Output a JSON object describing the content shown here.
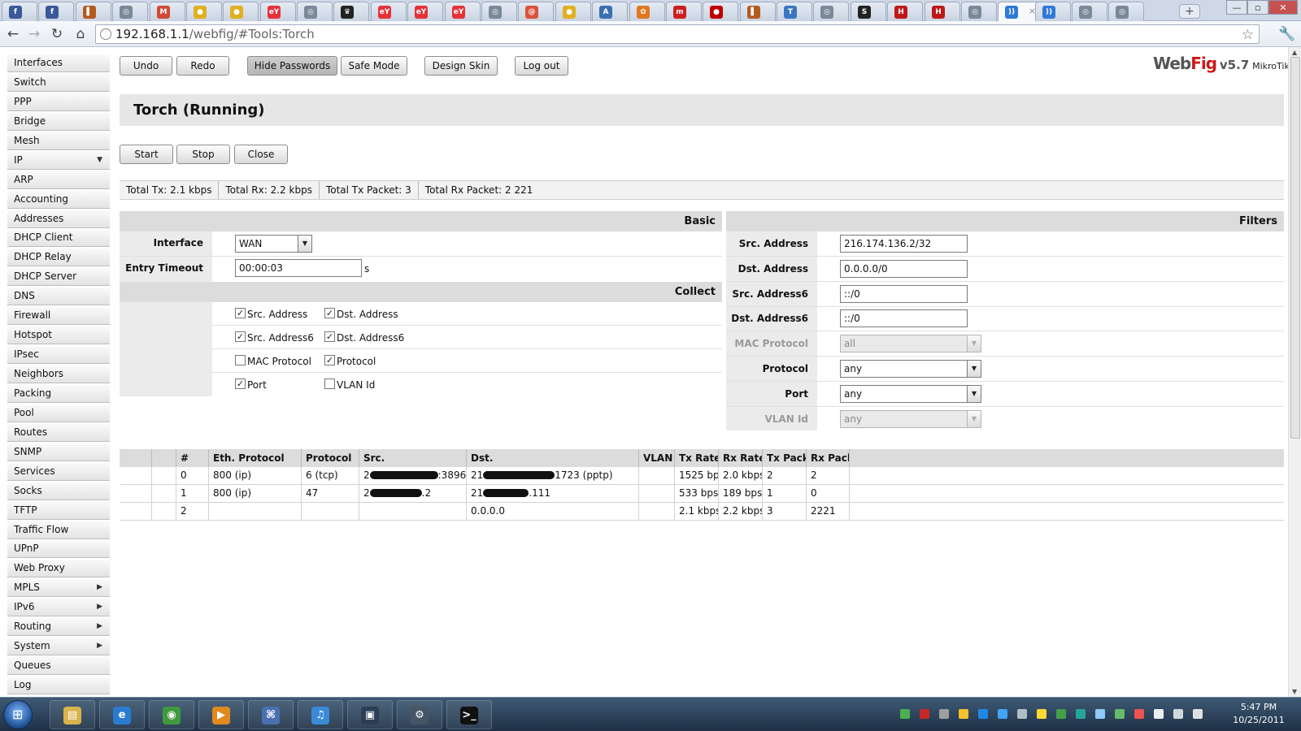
{
  "browser": {
    "tabs": [
      {
        "icon": "facebook-favicon",
        "color": "#3b5998",
        "glyph": "f"
      },
      {
        "icon": "facebook-favicon",
        "color": "#3b5998",
        "glyph": "f"
      },
      {
        "icon": "bookmark-favicon",
        "color": "#b35a1f",
        "glyph": "▌"
      },
      {
        "icon": "globe-favicon",
        "color": "#7a8898",
        "glyph": "◎"
      },
      {
        "icon": "gmail-favicon",
        "color": "#d14836",
        "glyph": "M"
      },
      {
        "icon": "orange-favicon",
        "color": "#e0b020",
        "glyph": "●"
      },
      {
        "icon": "orange-favicon",
        "color": "#e0b020",
        "glyph": "●"
      },
      {
        "icon": "ebay-favicon",
        "color": "#e53238",
        "glyph": "eY"
      },
      {
        "icon": "globe-favicon",
        "color": "#7a8898",
        "glyph": "◎"
      },
      {
        "icon": "crown-favicon",
        "color": "#222222",
        "glyph": "♛"
      },
      {
        "icon": "ebay-favicon",
        "color": "#e53238",
        "glyph": "eY"
      },
      {
        "icon": "ebay-favicon",
        "color": "#e53238",
        "glyph": "eY"
      },
      {
        "icon": "ebay-favicon",
        "color": "#e53238",
        "glyph": "eY"
      },
      {
        "icon": "globe-favicon",
        "color": "#7a8898",
        "glyph": "◎"
      },
      {
        "icon": "swirl-favicon",
        "color": "#d9533a",
        "glyph": "@"
      },
      {
        "icon": "orange-favicon",
        "color": "#e0b020",
        "glyph": "●"
      },
      {
        "icon": "tag-favicon",
        "color": "#3a6fb0",
        "glyph": "A"
      },
      {
        "icon": "gear-favicon",
        "color": "#e07820",
        "glyph": "✿"
      },
      {
        "icon": "m-favicon",
        "color": "#cc2020",
        "glyph": "m"
      },
      {
        "icon": "red-circle-favicon",
        "color": "#c00000",
        "glyph": "●"
      },
      {
        "icon": "bookmark-favicon",
        "color": "#b35a1f",
        "glyph": "▌"
      },
      {
        "icon": "t-favicon",
        "color": "#3a77c0",
        "glyph": "T"
      },
      {
        "icon": "globe-favicon",
        "color": "#7a8898",
        "glyph": "◎"
      },
      {
        "icon": "dark-favicon",
        "color": "#222222",
        "glyph": "S"
      },
      {
        "icon": "h-favicon",
        "color": "#c01818",
        "glyph": "H"
      },
      {
        "icon": "h-favicon",
        "color": "#c01818",
        "glyph": "H"
      },
      {
        "icon": "globe-favicon",
        "color": "#7a8898",
        "glyph": "◎"
      },
      {
        "icon": "rss-favicon",
        "color": "#2f7ad6",
        "glyph": "))"
      },
      {
        "icon": "rss-favicon",
        "color": "#2f7ad6",
        "glyph": "))"
      },
      {
        "icon": "globe-favicon",
        "color": "#7a8898",
        "glyph": "◎"
      },
      {
        "icon": "globe-favicon",
        "color": "#7a8898",
        "glyph": "◎"
      }
    ],
    "active_tab_close": "×",
    "new_tab": "+",
    "window_buttons": [
      "—",
      "▫",
      "✕"
    ],
    "url_host": "192.168.1.1",
    "url_path": "/webfig/#Tools:Torch"
  },
  "brand": {
    "part1": "Web",
    "part2": "Fig",
    "version": "v5.7",
    "vendor": "MikroTik"
  },
  "toolbar": {
    "undo": "Undo",
    "redo": "Redo",
    "hide_passwords": "Hide Passwords",
    "safe_mode": "Safe Mode",
    "design_skin": "Design Skin",
    "logout": "Log out"
  },
  "sidebar": [
    {
      "label": "Interfaces",
      "arrow": ""
    },
    {
      "label": "Switch",
      "arrow": ""
    },
    {
      "label": "PPP",
      "arrow": ""
    },
    {
      "label": "Bridge",
      "arrow": ""
    },
    {
      "label": "Mesh",
      "arrow": ""
    },
    {
      "label": "IP",
      "arrow": "▼"
    },
    {
      "label": "ARP",
      "arrow": ""
    },
    {
      "label": "Accounting",
      "arrow": ""
    },
    {
      "label": "Addresses",
      "arrow": ""
    },
    {
      "label": "DHCP Client",
      "arrow": ""
    },
    {
      "label": "DHCP Relay",
      "arrow": ""
    },
    {
      "label": "DHCP Server",
      "arrow": ""
    },
    {
      "label": "DNS",
      "arrow": ""
    },
    {
      "label": "Firewall",
      "arrow": ""
    },
    {
      "label": "Hotspot",
      "arrow": ""
    },
    {
      "label": "IPsec",
      "arrow": ""
    },
    {
      "label": "Neighbors",
      "arrow": ""
    },
    {
      "label": "Packing",
      "arrow": ""
    },
    {
      "label": "Pool",
      "arrow": ""
    },
    {
      "label": "Routes",
      "arrow": ""
    },
    {
      "label": "SNMP",
      "arrow": ""
    },
    {
      "label": "Services",
      "arrow": ""
    },
    {
      "label": "Socks",
      "arrow": ""
    },
    {
      "label": "TFTP",
      "arrow": ""
    },
    {
      "label": "Traffic Flow",
      "arrow": ""
    },
    {
      "label": "UPnP",
      "arrow": ""
    },
    {
      "label": "Web Proxy",
      "arrow": ""
    },
    {
      "label": "MPLS",
      "arrow": "▶"
    },
    {
      "label": "IPv6",
      "arrow": "▶"
    },
    {
      "label": "Routing",
      "arrow": "▶"
    },
    {
      "label": "System",
      "arrow": "▶"
    },
    {
      "label": "Queues",
      "arrow": ""
    },
    {
      "label": "Log",
      "arrow": ""
    }
  ],
  "page": {
    "title": "Torch (Running)"
  },
  "actions": {
    "start": "Start",
    "stop": "Stop",
    "close": "Close"
  },
  "status": {
    "total_tx": "Total Tx: 2.1 kbps",
    "total_rx": "Total Rx: 2.2 kbps",
    "total_tx_packet": "Total Tx Packet: 3",
    "total_rx_packet": "Total Rx Packet: 2 221"
  },
  "basic": {
    "header": "Basic",
    "interface_label": "Interface",
    "interface_value": "WAN",
    "entry_timeout_label": "Entry Timeout",
    "entry_timeout_value": "00:00:03",
    "entry_timeout_unit": "s"
  },
  "collect": {
    "header": "Collect",
    "options": [
      {
        "label": "Src. Address",
        "checked": true
      },
      {
        "label": "Dst. Address",
        "checked": true
      },
      {
        "label": "Src. Address6",
        "checked": true
      },
      {
        "label": "Dst. Address6",
        "checked": true
      },
      {
        "label": "MAC Protocol",
        "checked": false
      },
      {
        "label": "Protocol",
        "checked": true
      },
      {
        "label": "Port",
        "checked": true
      },
      {
        "label": "VLAN Id",
        "checked": false
      }
    ]
  },
  "filters": {
    "header": "Filters",
    "fields": [
      {
        "label": "Src. Address",
        "value": "216.174.136.2/32",
        "dropdown": false,
        "disabled": false
      },
      {
        "label": "Dst. Address",
        "value": "0.0.0.0/0",
        "dropdown": false,
        "disabled": false
      },
      {
        "label": "Src. Address6",
        "value": "::/0",
        "dropdown": false,
        "disabled": false
      },
      {
        "label": "Dst. Address6",
        "value": "::/0",
        "dropdown": false,
        "disabled": false
      },
      {
        "label": "MAC Protocol",
        "value": "all",
        "dropdown": true,
        "disabled": true
      },
      {
        "label": "Protocol",
        "value": "any",
        "dropdown": true,
        "disabled": false
      },
      {
        "label": "Port",
        "value": "any",
        "dropdown": true,
        "disabled": false
      },
      {
        "label": "VLAN Id",
        "value": "any",
        "dropdown": true,
        "disabled": true
      }
    ]
  },
  "table": {
    "columns": [
      "",
      "",
      "#",
      "Eth. Protocol",
      "Protocol",
      "Src.",
      "Dst.",
      "VLAN I",
      "Tx Rate",
      "Rx Rate",
      "Tx Pack",
      "Rx Pack"
    ],
    "rows": [
      [
        "",
        "",
        "0",
        "800 (ip)",
        "6 (tcp)",
        "2",
        ":3896",
        "21",
        "1723 (pptp)",
        "",
        "1525 bps",
        "2.0 kbps",
        "2",
        "2"
      ],
      [
        "",
        "",
        "1",
        "800 (ip)",
        "47",
        "2",
        ".2",
        "21",
        ".111",
        "",
        "533 bps",
        "189 bps",
        "1",
        "0"
      ],
      [
        "",
        "",
        "2",
        "",
        "",
        "",
        "",
        "0.0.0.0",
        "",
        "",
        "2.1 kbps",
        "2.2 kbps",
        "3",
        "2221"
      ]
    ]
  },
  "taskbar": {
    "start_glyph": "⊞",
    "apps": [
      {
        "name": "explorer",
        "color": "#d9b44a",
        "glyph": "▤"
      },
      {
        "name": "internet-explorer",
        "color": "#2a7bd1",
        "glyph": "e"
      },
      {
        "name": "chrome",
        "color": "#3f9a3f",
        "glyph": "◉"
      },
      {
        "name": "media-player",
        "color": "#e08a1e",
        "glyph": "▶"
      },
      {
        "name": "network-app",
        "color": "#4a70b0",
        "glyph": "⌘"
      },
      {
        "name": "itunes",
        "color": "#3a8ad6",
        "glyph": "♫"
      },
      {
        "name": "video-app",
        "color": "#2c3e56",
        "glyph": "▣"
      },
      {
        "name": "steam",
        "color": "#465566",
        "glyph": "⚙"
      },
      {
        "name": "command-prompt",
        "color": "#111111",
        "glyph": ">_"
      }
    ],
    "tray_colors": [
      "#4caf50",
      "#c62828",
      "#9e9e9e",
      "#fbc02d",
      "#1e88e5",
      "#42a5f5",
      "#b0bec5",
      "#fdd835",
      "#43a047",
      "#26a69a",
      "#90caf9",
      "#66bb6a",
      "#ef5350",
      "#eceff1",
      "#cfd8dc",
      "#e0e0e0"
    ],
    "time": "5:47 PM",
    "date": "10/25/2011"
  }
}
